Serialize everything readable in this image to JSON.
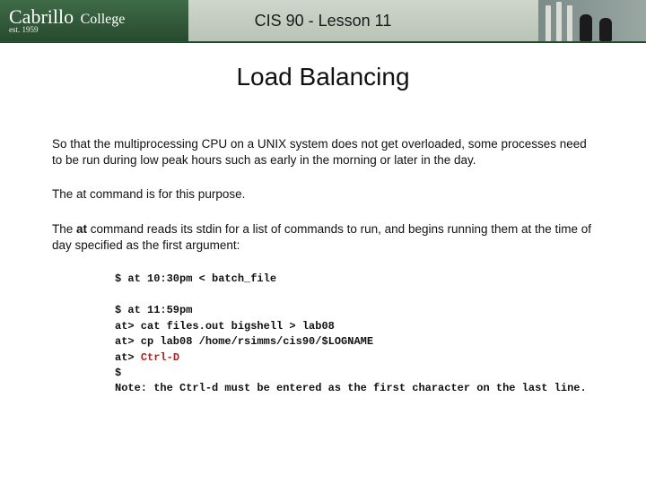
{
  "header": {
    "logo_line1": "Cabrillo",
    "logo_line2": "College",
    "logo_sub": "est. 1959",
    "title": "CIS 90 - Lesson 11"
  },
  "slide": {
    "title": "Load Balancing",
    "p1": "So that the multiprocessing CPU on a UNIX system does not get overloaded, some processes need to be run during low peak hours such as early in the morning or later in the day.",
    "p2": "The at command is for this purpose.",
    "p3_a": "The ",
    "p3_bold": "at",
    "p3_b": " command reads its stdin for a list of commands to run, and begins running them at the time of day specified as the first argument:"
  },
  "code": {
    "ex1": "$ at 10:30pm < batch_file",
    "ex2_l1": "$ at 11:59pm",
    "ex2_l2": "at> cat files.out bigshell > lab08",
    "ex2_l3": "at> cp lab08 /home/rsimms/cis90/$LOGNAME",
    "ex2_l4a": "at> ",
    "ex2_l4b": "Ctrl-D",
    "ex2_l5": "$",
    "ex2_l6": "Note: the Ctrl-d must be entered as the first character on the last line."
  }
}
